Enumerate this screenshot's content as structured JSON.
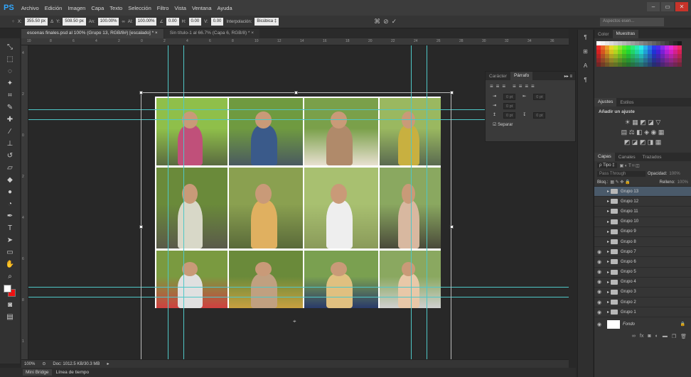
{
  "menubar": {
    "logo": "PS",
    "items": [
      "Archivo",
      "Edición",
      "Imagen",
      "Capa",
      "Texto",
      "Selección",
      "Filtro",
      "Vista",
      "Ventana",
      "Ayuda"
    ],
    "window_min": "–",
    "window_restore": "▭",
    "window_close": "✕"
  },
  "options": {
    "x_label": "X:",
    "x_value": "355.50 px",
    "y_label": "Y:",
    "y_value": "508.50 px",
    "w_label": "An:",
    "w_value": "100.00%",
    "h_label": "Al:",
    "h_value": "100.00%",
    "angle_value": "0.00",
    "hskew_label": "H:",
    "hskew_value": "0.00",
    "vskew_label": "V:",
    "vskew_value": "0.00",
    "interp_label": "Interpolación:",
    "interp_value": "Bicúbica ‡",
    "search_placeholder": "Aspectos esen..."
  },
  "tabs": [
    {
      "label": "escenas finales.psd al 100% (Grupo 13, RGB/8#) [escalado] * ×",
      "active": true
    },
    {
      "label": "Sin título-1 al 66.7% (Capa 6, RGB/8) * ×",
      "active": false
    }
  ],
  "ruler_top": [
    "10",
    "8",
    "6",
    "4",
    "2",
    "0",
    "2",
    "4",
    "6",
    "8",
    "10",
    "12",
    "14",
    "16",
    "18",
    "20",
    "22",
    "24",
    "26",
    "28",
    "30",
    "32",
    "34",
    "36"
  ],
  "ruler_left": [
    "4",
    "2",
    "0",
    "2",
    "4",
    "6",
    "8",
    "1"
  ],
  "status": {
    "zoom": "100%",
    "doc": "Doc: 1012.5 KB/30.3 MB"
  },
  "bottom_tabs": [
    "Mini Bridge",
    "Línea de tiempo"
  ],
  "paragraph_panel": {
    "tabs": [
      "Carácter",
      "Párrafo"
    ],
    "field_values": [
      "0 pt",
      "0 pt",
      "0 pt",
      "0 pt",
      "0 pt"
    ],
    "hyphen_label": "Separar"
  },
  "color_panel": {
    "tabs": [
      "Color",
      "Muestras"
    ]
  },
  "adjust_panel": {
    "tabs": [
      "Ajustes",
      "Estilos"
    ],
    "title": "Añadir un ajuste"
  },
  "layers_panel": {
    "tabs": [
      "Capas",
      "Canales",
      "Trazados"
    ],
    "filter": "ρ Tipo ‡",
    "blend": "Pass Through",
    "opacity_label": "Opacidad:",
    "opacity_value": "100%",
    "lock_label": "Bloq.:",
    "fill_label": "Relleno:",
    "fill_value": "100%",
    "layers": [
      {
        "name": "Grupo 13",
        "visible": false,
        "selected": true
      },
      {
        "name": "Grupo 12",
        "visible": false,
        "selected": false
      },
      {
        "name": "Grupo 11",
        "visible": false,
        "selected": false
      },
      {
        "name": "Grupo 10",
        "visible": false,
        "selected": false
      },
      {
        "name": "Grupo 9",
        "visible": false,
        "selected": false
      },
      {
        "name": "Grupo 8",
        "visible": false,
        "selected": false
      },
      {
        "name": "Grupo 7",
        "visible": true,
        "selected": false
      },
      {
        "name": "Grupo 6",
        "visible": true,
        "selected": false
      },
      {
        "name": "Grupo 5",
        "visible": true,
        "selected": false
      },
      {
        "name": "Grupo 4",
        "visible": true,
        "selected": false
      },
      {
        "name": "Grupo 3",
        "visible": true,
        "selected": false
      },
      {
        "name": "Grupo 2",
        "visible": true,
        "selected": false
      },
      {
        "name": "Grupo 1",
        "visible": true,
        "selected": false
      }
    ],
    "background_layer": "Fondo",
    "footer_icons": [
      "link-icon",
      "fx-icon",
      "mask-icon",
      "adjustment-icon",
      "folder-icon",
      "new-layer-icon",
      "trash-icon"
    ]
  },
  "photos": [
    {
      "name": "photo-01",
      "sky": "#8fbf4a",
      "ground": "#5a6a40",
      "person": "#c0507a"
    },
    {
      "name": "photo-02",
      "sky": "#6f9a40",
      "ground": "#4a5a60",
      "person": "#3a5a8a"
    },
    {
      "name": "photo-03",
      "sky": "#7aa04a",
      "ground": "#e8e0d0",
      "person": "#b08a6a"
    },
    {
      "name": "photo-04",
      "sky": "#9ab860",
      "ground": "#5a6a50",
      "person": "#c8b040"
    },
    {
      "name": "photo-05",
      "sky": "#6a8a3a",
      "ground": "#5a5a4a",
      "person": "#d8d8c8"
    },
    {
      "name": "photo-06",
      "sky": "#8aa050",
      "ground": "#5a6a3a",
      "person": "#e0b060"
    },
    {
      "name": "photo-07",
      "sky": "#a8c070",
      "ground": "#8a9a5a",
      "person": "#eeeeee"
    },
    {
      "name": "photo-08",
      "sky": "#8aa860",
      "ground": "#4a4a3a",
      "person": "#d8b8a0"
    },
    {
      "name": "photo-09",
      "sky": "#7a9a40",
      "ground": "#d04040",
      "person": "#e0e0e0"
    },
    {
      "name": "photo-10",
      "sky": "#6a8a3a",
      "ground": "#c8a040",
      "person": "#c0a080"
    },
    {
      "name": "photo-11",
      "sky": "#7aa050",
      "ground": "#2a3a6a",
      "person": "#e0c080"
    },
    {
      "name": "photo-12",
      "sky": "#8aa860",
      "ground": "#d0d0d0",
      "person": "#e8c8a8"
    }
  ]
}
